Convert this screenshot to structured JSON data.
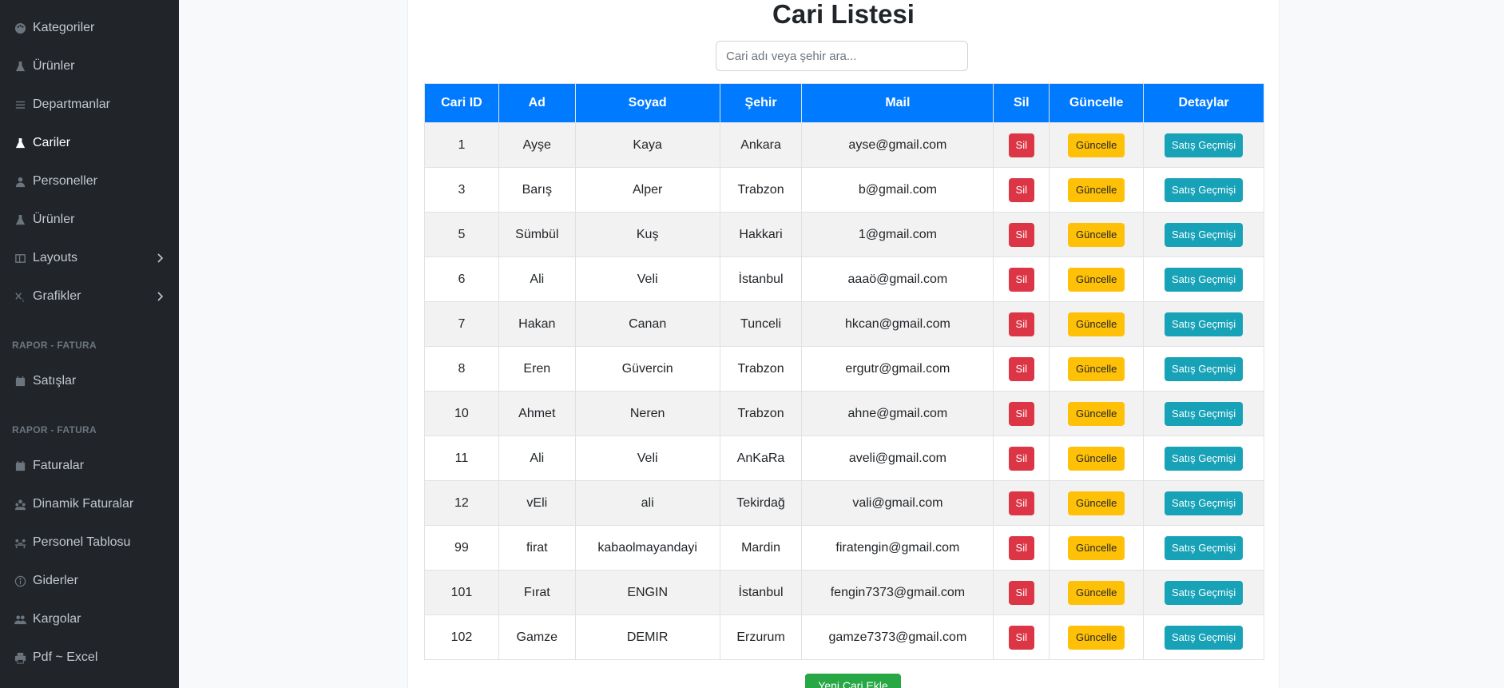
{
  "sidebar": {
    "items": [
      {
        "label": "Kategoriler",
        "icon": "palette-icon"
      },
      {
        "label": "Ürünler",
        "icon": "flask-icon"
      },
      {
        "label": "Departmanlar",
        "icon": "list-icon"
      },
      {
        "label": "Cariler",
        "icon": "flask-icon",
        "active": true
      },
      {
        "label": "Personeller",
        "icon": "user-icon"
      },
      {
        "label": "Ürünler",
        "icon": "flask-icon"
      },
      {
        "label": "Layouts",
        "icon": "columns-icon",
        "expandable": true
      },
      {
        "label": "Grafikler",
        "icon": "subscript-icon",
        "expandable": true
      }
    ],
    "section1": "RAPOR - FATURA",
    "section1_items": [
      {
        "label": "Satışlar",
        "icon": "calendar-icon"
      }
    ],
    "section2": "RAPOR - FATURA",
    "section2_items": [
      {
        "label": "Faturalar",
        "icon": "calendar-icon"
      },
      {
        "label": "Dinamik Faturalar",
        "icon": "users-group-icon"
      },
      {
        "label": "Personel Tablosu",
        "icon": "people-table-icon"
      },
      {
        "label": "Giderler",
        "icon": "info-circle-icon"
      },
      {
        "label": "Kargolar",
        "icon": "users-icon"
      },
      {
        "label": "Pdf ~ Excel",
        "icon": "print-icon"
      }
    ]
  },
  "main": {
    "title": "Cari Listesi",
    "search_placeholder": "Cari adı veya şehir ara...",
    "columns": [
      "Cari ID",
      "Ad",
      "Soyad",
      "Şehir",
      "Mail",
      "Sil",
      "Güncelle",
      "Detaylar"
    ],
    "buttons": {
      "delete": "Sil",
      "update": "Güncelle",
      "details": "Satış Geçmişi"
    },
    "rows": [
      {
        "id": "1",
        "ad": "Ayşe",
        "soyad": "Kaya",
        "sehir": "Ankara",
        "mail": "ayse@gmail.com"
      },
      {
        "id": "3",
        "ad": "Barış",
        "soyad": "Alper",
        "sehir": "Trabzon",
        "mail": "b@gmail.com"
      },
      {
        "id": "5",
        "ad": "Sümbül",
        "soyad": "Kuş",
        "sehir": "Hakkari",
        "mail": "1@gmail.com"
      },
      {
        "id": "6",
        "ad": "Ali",
        "soyad": "Veli",
        "sehir": "İstanbul",
        "mail": "aaaö@gmail.com"
      },
      {
        "id": "7",
        "ad": "Hakan",
        "soyad": "Canan",
        "sehir": "Tunceli",
        "mail": "hkcan@gmail.com"
      },
      {
        "id": "8",
        "ad": "Eren",
        "soyad": "Güvercin",
        "sehir": "Trabzon",
        "mail": "ergutr@gmail.com"
      },
      {
        "id": "10",
        "ad": "Ahmet",
        "soyad": "Neren",
        "sehir": "Trabzon",
        "mail": "ahne@gmail.com"
      },
      {
        "id": "11",
        "ad": "Ali",
        "soyad": "Veli",
        "sehir": "AnKaRa",
        "mail": "aveli@gmail.com"
      },
      {
        "id": "12",
        "ad": "vEli",
        "soyad": "ali",
        "sehir": "Tekirdağ",
        "mail": "vali@gmail.com"
      },
      {
        "id": "99",
        "ad": "firat",
        "soyad": "kabaolmayandayi",
        "sehir": "Mardin",
        "mail": "firatengin@gmail.com"
      },
      {
        "id": "101",
        "ad": "Fırat",
        "soyad": "ENGIN",
        "sehir": "İstanbul",
        "mail": "fengin7373@gmail.com"
      },
      {
        "id": "102",
        "ad": "Gamze",
        "soyad": "DEMIR",
        "sehir": "Erzurum",
        "mail": "gamze7373@gmail.com"
      }
    ],
    "new_button": "Yeni Cari Ekle"
  },
  "colors": {
    "sidebar_bg": "#212529",
    "header_blue": "#007bff",
    "danger": "#dc3545",
    "warning": "#ffc107",
    "info": "#17a2b8",
    "success": "#28a745"
  }
}
